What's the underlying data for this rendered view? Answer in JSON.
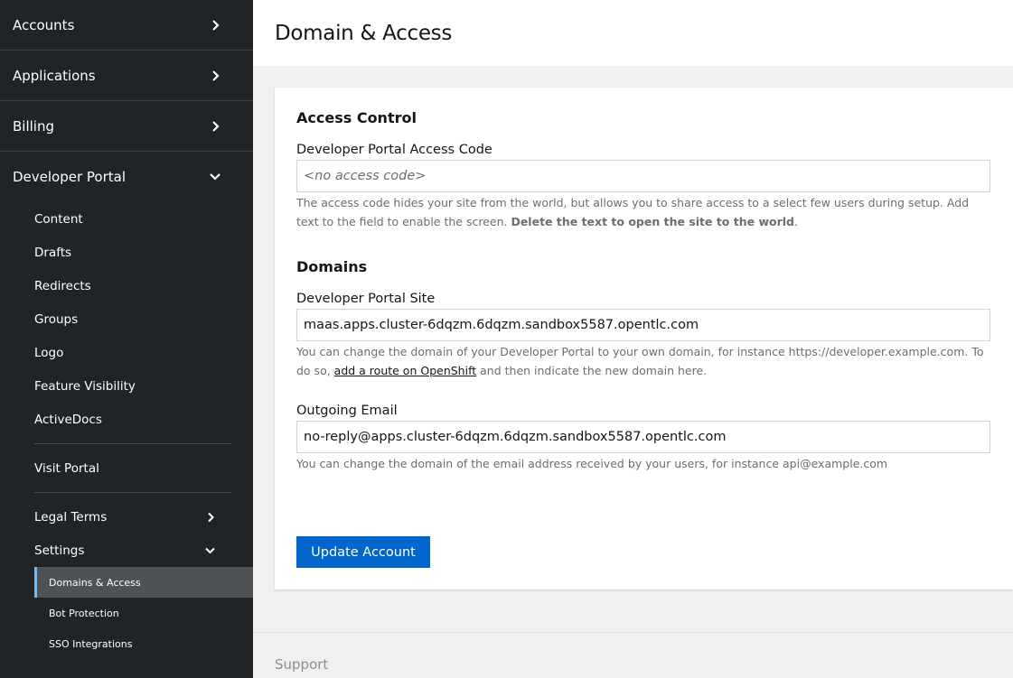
{
  "sidebar": {
    "top_items": [
      {
        "label": "Accounts"
      },
      {
        "label": "Applications"
      },
      {
        "label": "Billing"
      },
      {
        "label": "Developer Portal"
      }
    ],
    "portal_items": [
      "Content",
      "Drafts",
      "Redirects",
      "Groups",
      "Logo",
      "Feature Visibility",
      "ActiveDocs"
    ],
    "visit_portal": "Visit Portal",
    "legal_terms": "Legal Terms",
    "settings": "Settings",
    "settings_items": [
      "Domains & Access",
      "Bot Protection",
      "SSO Integrations"
    ]
  },
  "header": {
    "title": "Domain & Access"
  },
  "access_control": {
    "heading": "Access Control",
    "field_label": "Developer Portal Access Code",
    "placeholder": "<no access code>",
    "value": "",
    "help_text": "The access code hides your site from the world, but allows you to share access to a select few users during setup. Add text to the field to enable the screen. ",
    "help_bold": "Delete the text to open the site to the world",
    "help_end": "."
  },
  "domains": {
    "heading": "Domains",
    "site_label": "Developer Portal Site",
    "site_value": "maas.apps.cluster-6dqzm.6dqzm.sandbox5587.opentlc.com",
    "site_help_1": "You can change the domain of your Developer Portal to your own domain, for instance https://developer.example.com. To do so, ",
    "site_help_link": "add a route on OpenShift",
    "site_help_2": " and then indicate the new domain here.",
    "email_label": "Outgoing Email",
    "email_value": "no-reply@apps.cluster-6dqzm.6dqzm.sandbox5587.opentlc.com",
    "email_help": "You can change the domain of the email address received by your users, for instance api@example.com"
  },
  "button": {
    "label": "Update Account"
  },
  "footer": {
    "support": "Support"
  }
}
